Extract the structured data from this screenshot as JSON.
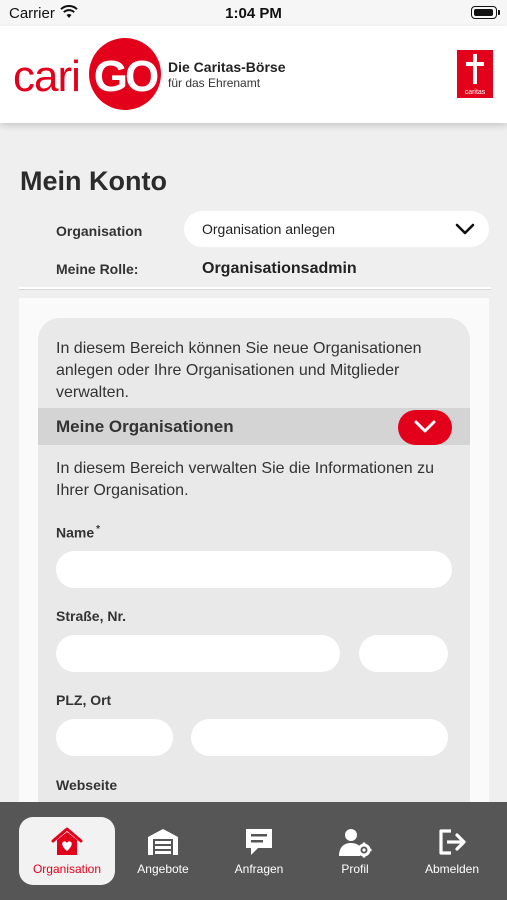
{
  "status_bar": {
    "carrier": "Carrier",
    "time": "1:04 PM"
  },
  "header": {
    "logo_part1": "cari",
    "logo_part2": "GO",
    "tagline_line1": "Die Caritas-Börse",
    "tagline_line2": "für das Ehrenamt",
    "partner_logo_text": "caritas"
  },
  "page": {
    "title": "Mein Konto",
    "organisation_label": "Organisation",
    "organisation_value": "Organisation anlegen",
    "role_label": "Meine Rolle:",
    "role_value": "Organisationsadmin"
  },
  "card": {
    "intro": "In diesem Bereich können Sie neue Organisationen anlegen oder Ihre Organisationen und Mitglieder verwalten.",
    "section_title": "Meine Organisationen",
    "section_description": "In diesem Bereich verwalten Sie die Informationen zu Ihrer Organisation.",
    "fields": {
      "name_label": "Name",
      "name_required_mark": "*",
      "street_label": "Straße, Nr.",
      "zip_city_label": "PLZ, Ort",
      "website_label": "Webseite"
    }
  },
  "tabbar": {
    "active_color": "#e3001b",
    "tabs": [
      {
        "label": "Organisation",
        "icon": "house-heart-icon",
        "active": true
      },
      {
        "label": "Angebote",
        "icon": "garage-icon",
        "active": false
      },
      {
        "label": "Anfragen",
        "icon": "chat-bubble-icon",
        "active": false
      },
      {
        "label": "Profil",
        "icon": "user-gear-icon",
        "active": false
      },
      {
        "label": "Abmelden",
        "icon": "logout-icon",
        "active": false
      }
    ]
  }
}
